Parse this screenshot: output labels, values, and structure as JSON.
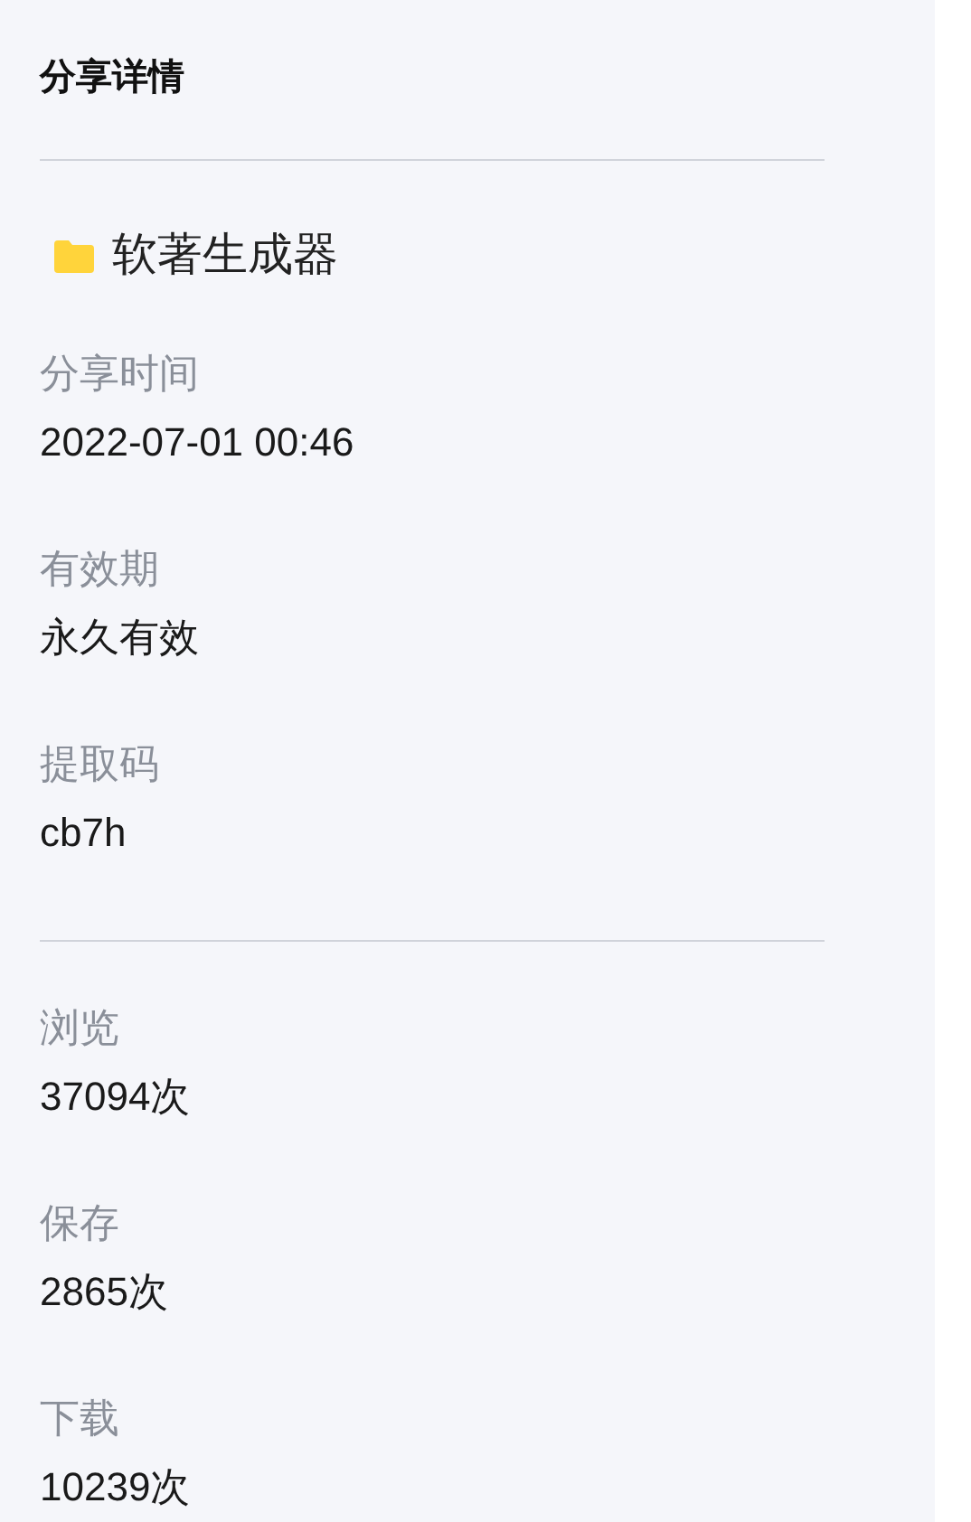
{
  "title": "分享详情",
  "file": {
    "name": "软著生成器"
  },
  "sections": [
    [
      {
        "label": "分享时间",
        "value": "2022-07-01 00:46"
      },
      {
        "label": "有效期",
        "value": "永久有效"
      },
      {
        "label": "提取码",
        "value": "cb7h"
      }
    ],
    [
      {
        "label": "浏览",
        "value": "37094次"
      },
      {
        "label": "保存",
        "value": "2865次"
      },
      {
        "label": "下载",
        "value": "10239次"
      }
    ]
  ]
}
